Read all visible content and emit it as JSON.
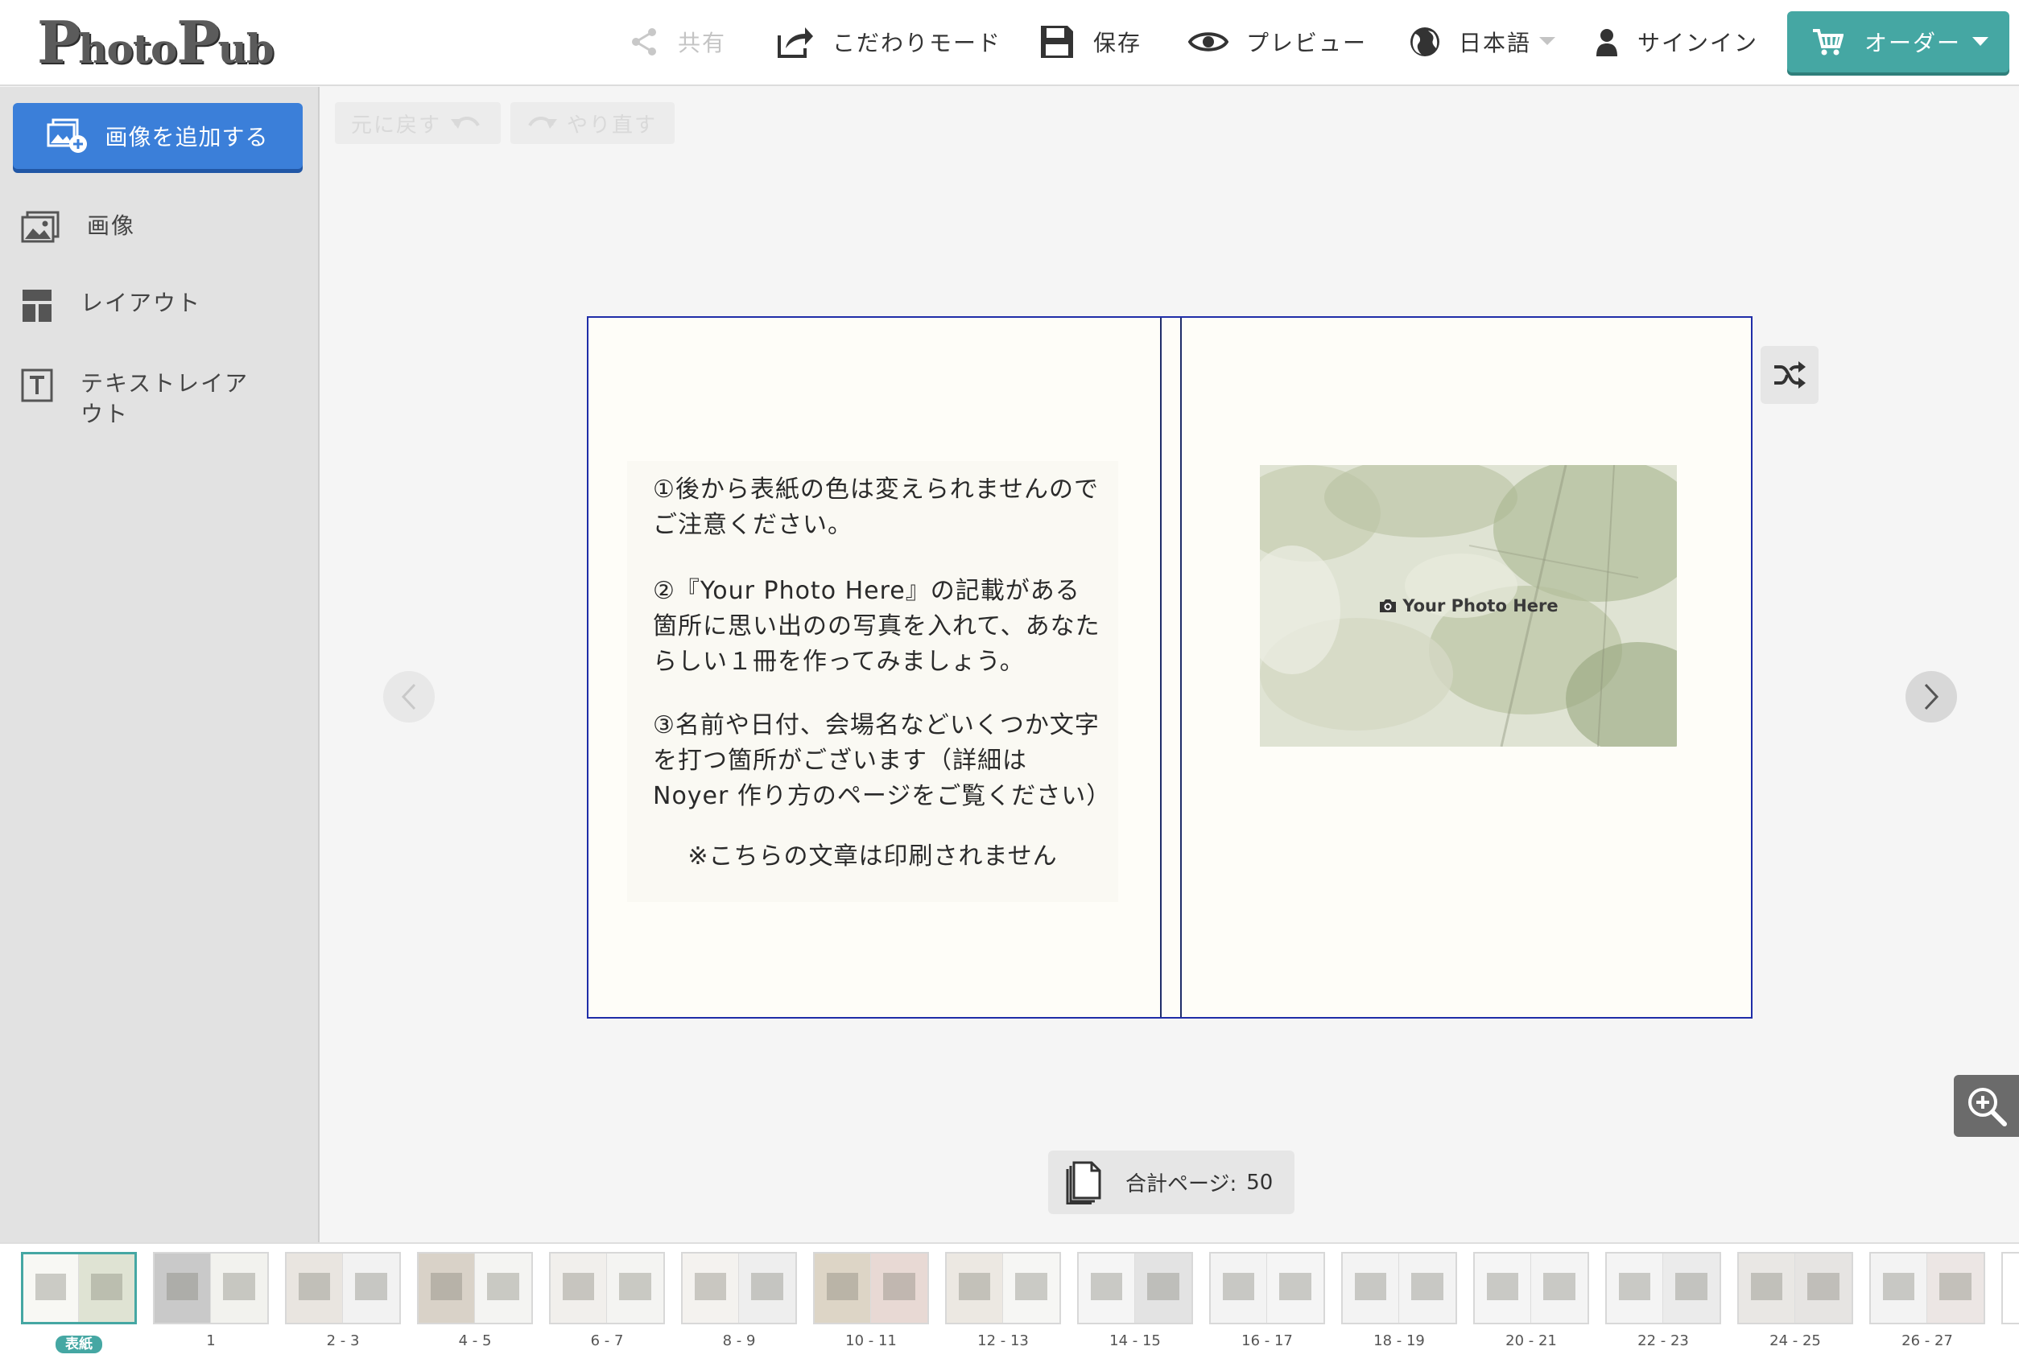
{
  "header": {
    "logo": "PhotoPub",
    "share": "共有",
    "custom_mode": "こだわりモード",
    "save": "保存",
    "preview": "プレビュー",
    "language": "日本語",
    "signin": "サインイン",
    "order": "オーダー"
  },
  "sidebar": {
    "add_images": "画像を追加する",
    "items": [
      {
        "label": "画像",
        "icon": "image-icon"
      },
      {
        "label": "レイアウト",
        "icon": "layout-icon"
      },
      {
        "label": "テキストレイアウト",
        "icon": "text-layout-icon"
      }
    ]
  },
  "toolbar": {
    "undo": "元に戻す",
    "redo": "やり直す"
  },
  "editor": {
    "note": {
      "p1": "①後から表紙の色は変えられませんのでご注意ください。",
      "p2": "②『Your Photo Here』の記載がある箇所に思い出のの写真を入れて、あなたらしい１冊を作ってみましょう。",
      "p3": "③名前や日付、会場名などいくつか文字を打つ箇所がございます（詳細は Noyer 作り方のページをご覧ください）",
      "p4": "※こちらの文章は印刷されません"
    },
    "photo_placeholder": "Your Photo Here"
  },
  "page_count": {
    "label": "合計ページ:",
    "value": "50"
  },
  "filmstrip": [
    {
      "label": "表紙",
      "active": true
    },
    {
      "label": "1"
    },
    {
      "label": "2 - 3"
    },
    {
      "label": "4 - 5"
    },
    {
      "label": "6 - 7"
    },
    {
      "label": "8 - 9"
    },
    {
      "label": "10 - 11"
    },
    {
      "label": "12 - 13"
    },
    {
      "label": "14 - 15"
    },
    {
      "label": "16 - 17"
    },
    {
      "label": "18 - 19"
    },
    {
      "label": "20 - 21"
    },
    {
      "label": "22 - 23"
    },
    {
      "label": "24 - 25"
    },
    {
      "label": "26 - 27"
    }
  ],
  "colors": {
    "accent_teal": "#45a7a3",
    "primary_blue": "#3b7fd9",
    "spread_border": "#1f2da8"
  }
}
